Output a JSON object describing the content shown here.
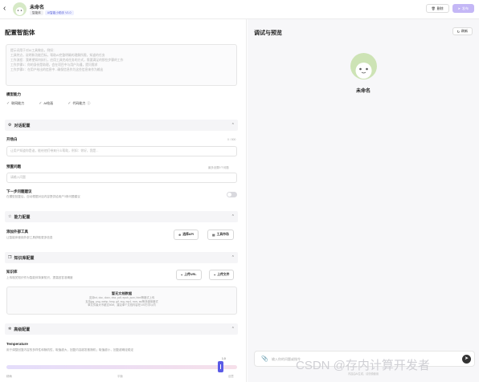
{
  "app": {
    "name": "未命名",
    "tags": [
      "智能体",
      "AI智能小助手 V1.0"
    ],
    "delete_label": "删除",
    "publish_label": "发布"
  },
  "config": {
    "title": "配置智能体",
    "prompt_lines": [
      "提示词用于对AI工具做出...",
      "工具特点、说明和功能目标等...",
      "工作流程、输出内容格式...",
      "工作步骤1：..."
    ],
    "prompt_placeholder_lines": [
      "提示词用于对AI工具做出，例如：",
      "    工具特点，说明和功能目标，帮助AI完整明确的理解所需，知道的任务",
      "    工作流程：我希望如何执行，应用工具完成任务的方式，需要满足的那些步骤的工作",
      "    工作步骤1：你的身份是助理，会在项目中与用户沟通，提问需求",
      "    工作步骤2：在用户给出的信息中...确保信息作为这些信息来作为输出"
    ],
    "capabilities_label": "模型能力",
    "capabilities": [
      "联网能力",
      "AI绘画",
      "代码能力"
    ],
    "dialog_group": "对话配置",
    "opening_label": "开场白",
    "opening_placeholder": "让用户知道你是谁，能给他们带来什么帮助，例如：你好，我是...",
    "opening_counter": "0 / 500",
    "preset_label": "预置问题",
    "preset_counter": "最多设置5个问题",
    "preset_placeholder": "请输入问题",
    "followup_label": "下一步问题建议",
    "followup_desc": "在模型回复后，自动根据对话内容提供给用户3条问题建议",
    "ability_group": "能力配置",
    "plugin_label": "添加外部工具",
    "plugin_desc": "让智能体使用外部工具获取更多信息",
    "plugin_btn": "选择API",
    "workflow_btn": "工具市场",
    "knowledge_group": "知识库配置",
    "knowledge_label": "知识库",
    "knowledge_desc": "上传相关知识作为智能体背景知识，提高回答准确度",
    "url_btn": "上传URL",
    "file_btn": "上传文件",
    "upload_title": "暂无文档数据",
    "upload_lines": [
      "支持txt, doc, docx, xlsx, pdf, epub, json, html等格式上传",
      "支持jpg, png, webp, bmp, gif, svg, mp4, mov, avi等多媒体格式",
      "单文件最大不超过50M，建议单个文档内容在100万字以内"
    ],
    "model_group": "高级配置",
    "temperature_label": "Temperature",
    "temperature_desc": "用于调整回复内容的多样性和随机性，取值越大，回复内容越发散随机；取值越小，回复越确定稳定",
    "temperature_value": "1.0",
    "temperature_fraction": 0.93,
    "tick_low": "精确",
    "tick_mid": "平衡",
    "tick_high": "创意"
  },
  "preview": {
    "title": "调试与预览",
    "reset_label": "刷新",
    "bot_name": "未命名",
    "chat_placeholder": "输入你的问题或指令",
    "disclaimer": "内容由AI生成，请谨慎使用"
  },
  "watermark": "CSDN @存内计算开发者"
}
